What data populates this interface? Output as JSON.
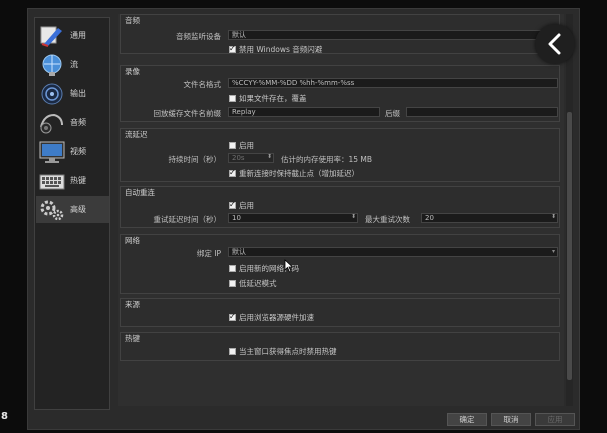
{
  "corner_label": "8",
  "sidebar": {
    "items": [
      {
        "label": "通用",
        "icon": "general-icon"
      },
      {
        "label": "流",
        "icon": "stream-icon"
      },
      {
        "label": "输出",
        "icon": "output-icon"
      },
      {
        "label": "音频",
        "icon": "audio-icon"
      },
      {
        "label": "视频",
        "icon": "video-icon"
      },
      {
        "label": "热键",
        "icon": "hotkeys-icon"
      },
      {
        "label": "高级",
        "icon": "advanced-icon"
      }
    ],
    "active_index": 6
  },
  "audio": {
    "title": "音频",
    "monitor_label": "音频监听设备",
    "monitor_value": "默认",
    "disable_ducking_label": "禁用 Windows 音频闪避",
    "disable_ducking_checked": true
  },
  "recording": {
    "title": "录像",
    "filename_format_label": "文件名格式",
    "filename_format_value": "%CCYY-%MM-%DD %hh-%mm-%ss",
    "overwrite_label": "如果文件存在，覆盖",
    "overwrite_checked": false,
    "replay_prefix_label": "回放缓存文件名前缀",
    "replay_prefix_value": "Replay",
    "suffix_label": "后缀",
    "suffix_value": ""
  },
  "stream_delay": {
    "title": "流延迟",
    "enable_label": "启用",
    "enable_checked": false,
    "duration_label": "持续时间（秒）",
    "duration_value": "20s",
    "memory_estimate": "估计的内存使用率：15 MB",
    "preserve_label": "重新连接时保持截止点（增加延迟）",
    "preserve_checked": true
  },
  "auto_reconnect": {
    "title": "自动重连",
    "enable_label": "启用",
    "enable_checked": true,
    "retry_delay_label": "重试延迟时间（秒）",
    "retry_delay_value": "10",
    "max_retries_label": "最大重试次数",
    "max_retries_value": "20"
  },
  "network": {
    "title": "网络",
    "bind_ip_label": "绑定 IP",
    "bind_ip_value": "默认",
    "new_network_code_label": "启用新的网络代码",
    "new_network_code_checked": false,
    "low_latency_label": "低延迟模式",
    "low_latency_checked": false
  },
  "sources": {
    "title": "来源",
    "browser_accel_label": "启用浏览器源硬件加速",
    "browser_accel_checked": true
  },
  "hotkeys": {
    "title": "热键",
    "disable_unfocused_label": "当主窗口获得焦点时禁用热键",
    "disable_unfocused_checked": false
  },
  "footer": {
    "ok_label": "确定",
    "cancel_label": "取消",
    "apply_label": "应用"
  }
}
